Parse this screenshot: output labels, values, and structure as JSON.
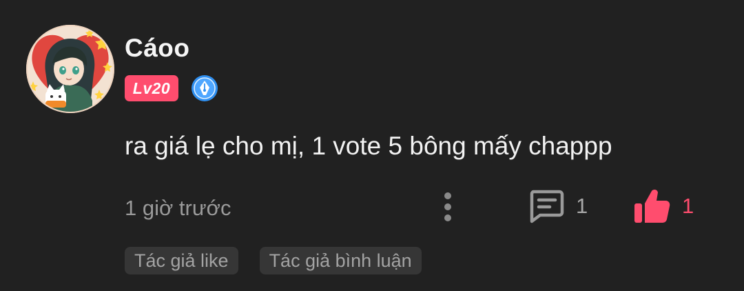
{
  "comment": {
    "author": "Cáoo",
    "level": "Lv20",
    "text": "ra giá lẹ cho mị, 1 vote 5 bông mấy chappp",
    "time": "1 giờ trước",
    "reply_count": "1",
    "like_count": "1",
    "tags": [
      "Tác giả like",
      "Tác giả bình luận"
    ]
  },
  "icons": {
    "avatar": "avatar-image",
    "writer_badge": "pen-nib-icon",
    "more": "more-vertical-icon",
    "reply": "comment-icon",
    "like": "thumbs-up-icon"
  },
  "colors": {
    "background": "#212121",
    "accent": "#ff4d6e",
    "badge_blue": "#2f8ff0",
    "muted_text": "#9a9a9a",
    "tag_background": "#363636"
  }
}
